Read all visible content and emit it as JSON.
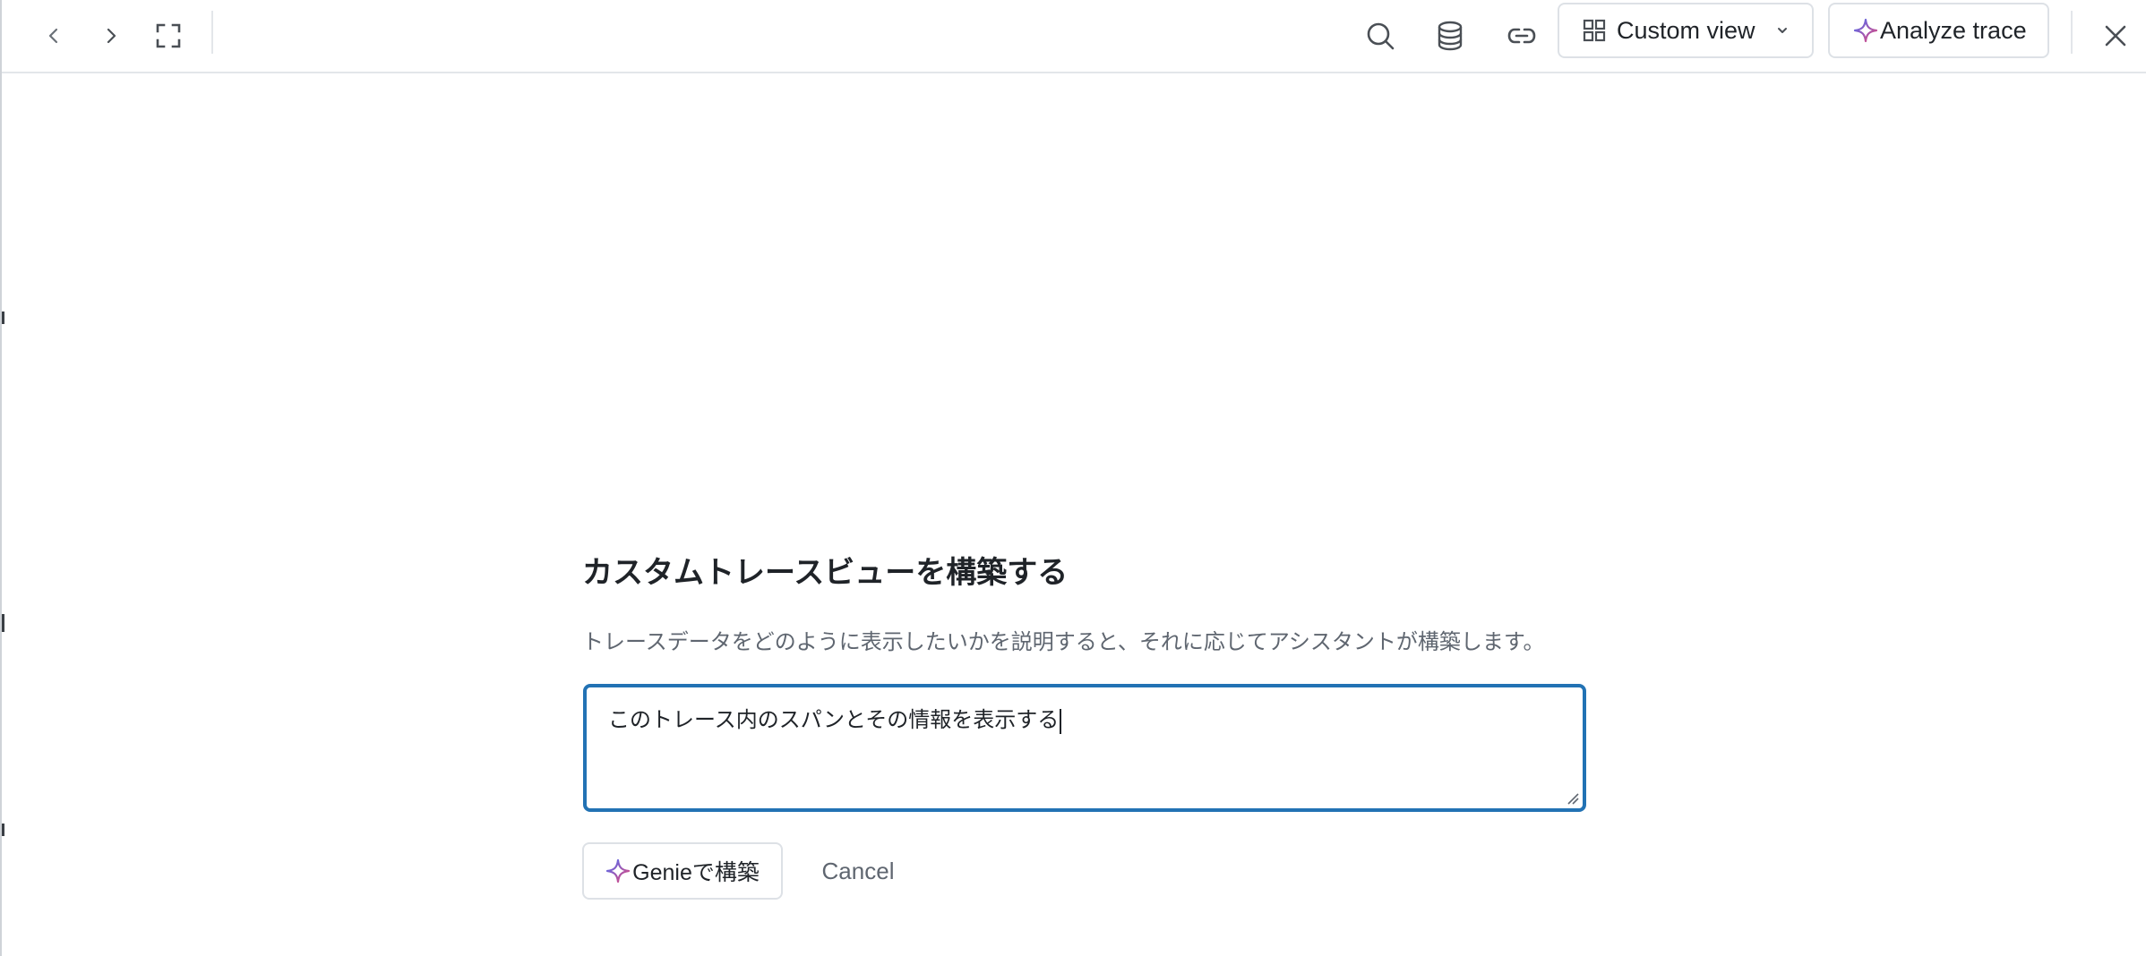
{
  "toolbar": {
    "custom_view_label": "Custom view",
    "analyze_label": "Analyze trace"
  },
  "dialog": {
    "title": "カスタムトレースビューを構築する",
    "description": "トレースデータをどのように表示したいかを説明すると、それに応じてアシスタントが構築します。",
    "prompt_value": "このトレース内のスパンとその情報を表示する",
    "build_label": "Genieで構築",
    "cancel_label": "Cancel"
  },
  "colors": {
    "accent_border": "#2272b4",
    "sparkle_start": "#4c6ef5",
    "sparkle_end": "#e5477a"
  },
  "icons": {
    "back": "chevron-left-icon",
    "forward": "chevron-right-icon",
    "fullscreen": "expand-icon",
    "search": "search-icon",
    "database": "database-icon",
    "link": "link-icon",
    "grid": "grid-icon",
    "dropdown": "chevron-down-icon",
    "sparkle": "sparkle-icon",
    "close": "close-icon"
  }
}
